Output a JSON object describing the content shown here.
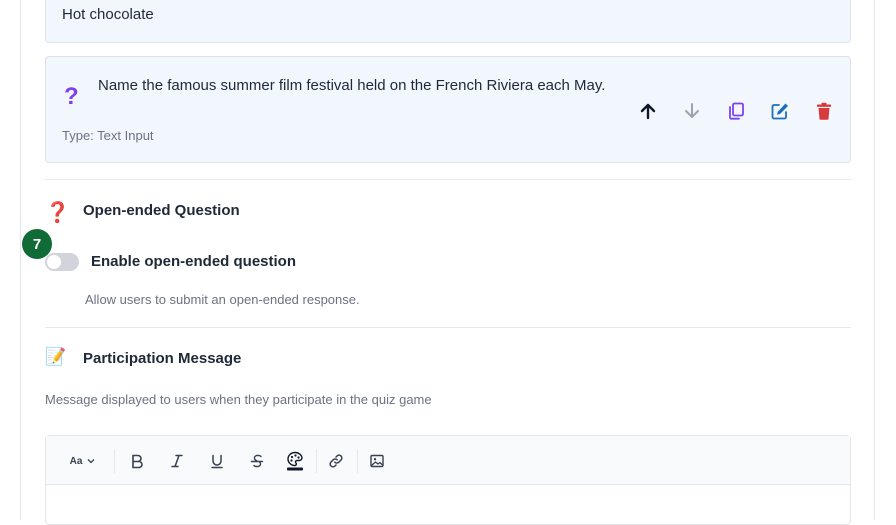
{
  "answer_option": {
    "text": "Hot chocolate"
  },
  "question": {
    "icon": "question-mark-icon",
    "text": "Name the famous summer film festival held on the French Riviera each May.",
    "type_label": "Type: Text Input",
    "actions": [
      "arrow-up-icon",
      "arrow-down-icon",
      "duplicate-icon",
      "edit-icon",
      "trash-icon"
    ]
  },
  "open_ended": {
    "icon": "red-question-mark-icon",
    "title": "Open-ended Question",
    "step_badge": "7",
    "toggle_label": "Enable open-ended question",
    "toggle_on": false,
    "description": "Allow users to submit an open-ended response."
  },
  "participation": {
    "icon": "memo-icon",
    "title": "Participation Message",
    "description": "Message displayed to users when they participate in the quiz game"
  },
  "editor": {
    "font_size_label": "Aa",
    "tools": [
      "font-size-dropdown",
      "bold",
      "italic",
      "underline",
      "strikethrough",
      "text-color",
      "link",
      "image"
    ]
  },
  "colors": {
    "question_icon": "#7e3ff2",
    "duplicate_icon": "#7e3ff2",
    "edit_icon": "#1d6fb8",
    "delete_icon": "#d83b3b",
    "badge_bg": "#116b37",
    "panel_bg": "#f2f7fd"
  }
}
